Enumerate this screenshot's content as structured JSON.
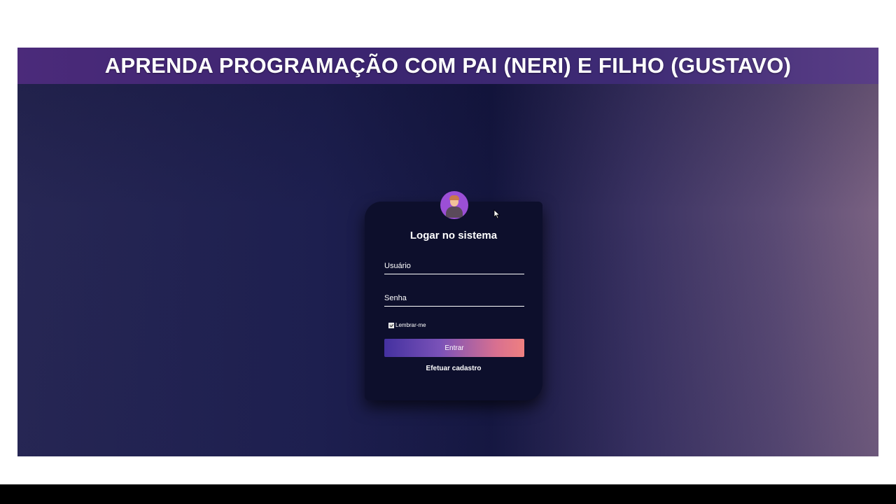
{
  "banner": {
    "title": "APRENDA PROGRAMAÇÃO COM PAI (NERI) E FILHO (GUSTAVO)"
  },
  "login": {
    "heading": "Logar no sistema",
    "username_placeholder": "Usuário",
    "password_placeholder": "Senha",
    "remember_label": "Lembrar-me",
    "remember_checked": true,
    "submit_label": "Entrar",
    "register_label": "Efetuar cadastro",
    "avatar_icon": "user-avatar-icon"
  },
  "colors": {
    "card_background": "#0d0f2c",
    "avatar_background": "#9b4fd6",
    "button_gradient_start": "#4431a0",
    "button_gradient_end": "#ef8080"
  }
}
